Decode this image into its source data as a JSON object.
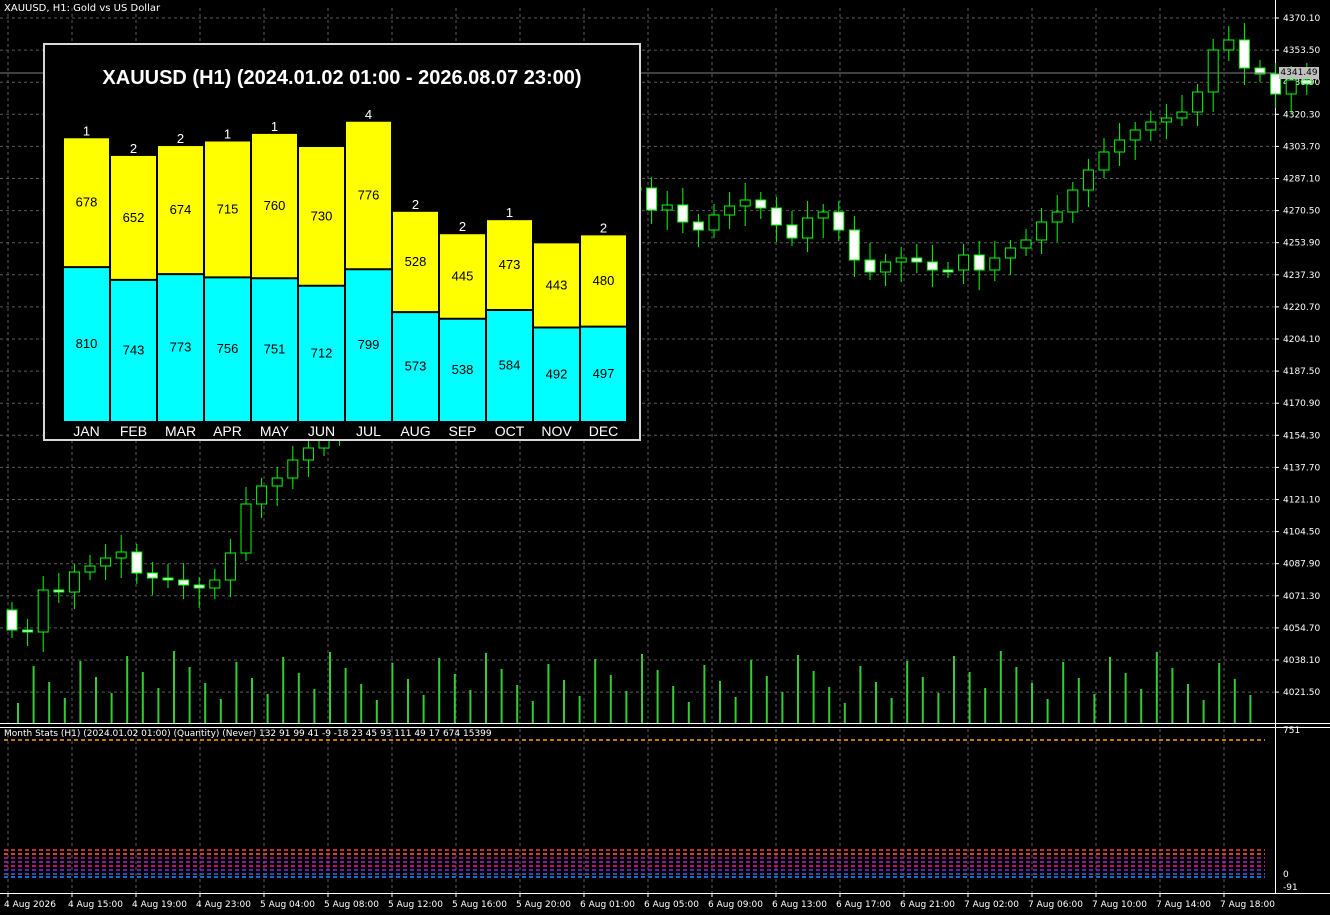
{
  "window": {
    "symbol_title": "XAUUSD, H1:  Gold vs US Dollar",
    "current_price": "4341.49"
  },
  "price_axis": {
    "labels": [
      "4370.10",
      "4353.50",
      "4336.90",
      "4320.30",
      "4303.70",
      "4287.10",
      "4270.50",
      "4253.90",
      "4237.30",
      "4220.70",
      "4204.10",
      "4187.50",
      "4170.90",
      "4154.30",
      "4137.70",
      "4121.10",
      "4104.50",
      "4087.90",
      "4071.30",
      "4054.70",
      "4038.10",
      "4021.50"
    ]
  },
  "time_axis": {
    "labels": [
      "4 Aug 2026",
      "4 Aug 15:00",
      "4 Aug 19:00",
      "4 Aug 23:00",
      "5 Aug 04:00",
      "5 Aug 08:00",
      "5 Aug 12:00",
      "5 Aug 16:00",
      "5 Aug 20:00",
      "6 Aug 01:00",
      "6 Aug 05:00",
      "6 Aug 09:00",
      "6 Aug 13:00",
      "6 Aug 17:00",
      "6 Aug 21:00",
      "7 Aug 02:00",
      "7 Aug 06:00",
      "7 Aug 10:00",
      "7 Aug 14:00",
      "7 Aug 18:00"
    ]
  },
  "indicator": {
    "title": "Month Stats  (H1) (2024.01.02 01:00) (Quantity) (Never)  132 91 99 41 -9 -18 23 45 93 111 49 17 674 15399",
    "scale_top": "751",
    "scale_zero": "0",
    "scale_bottom": "-91"
  },
  "colors": {
    "bull": "#00ff00",
    "bear_body": "#ffffff",
    "grid": "#5a5a5a",
    "volume": "#32cd32",
    "stats_top": "#ffff00",
    "stats_bottom": "#00ffff"
  },
  "chart_data": {
    "type": "bar",
    "title": "XAUUSD (H1) (2024.01.02 01:00 - 2026.08.07 23:00)",
    "categories": [
      "JAN",
      "FEB",
      "MAR",
      "APR",
      "MAY",
      "JUN",
      "JUL",
      "AUG",
      "SEP",
      "OCT",
      "NOV",
      "DEC"
    ],
    "series": [
      {
        "values": [
          810,
          743,
          773,
          756,
          751,
          712,
          799,
          573,
          538,
          584,
          492,
          497
        ]
      },
      {
        "values": [
          678,
          652,
          674,
          715,
          760,
          730,
          776,
          528,
          445,
          473,
          443,
          480
        ]
      }
    ],
    "top_labels": [
      "1",
      "2",
      "2",
      "1",
      "1",
      "",
      "4",
      "2",
      "2",
      "1",
      "",
      "2"
    ],
    "ylim": [
      0,
      1650
    ]
  }
}
